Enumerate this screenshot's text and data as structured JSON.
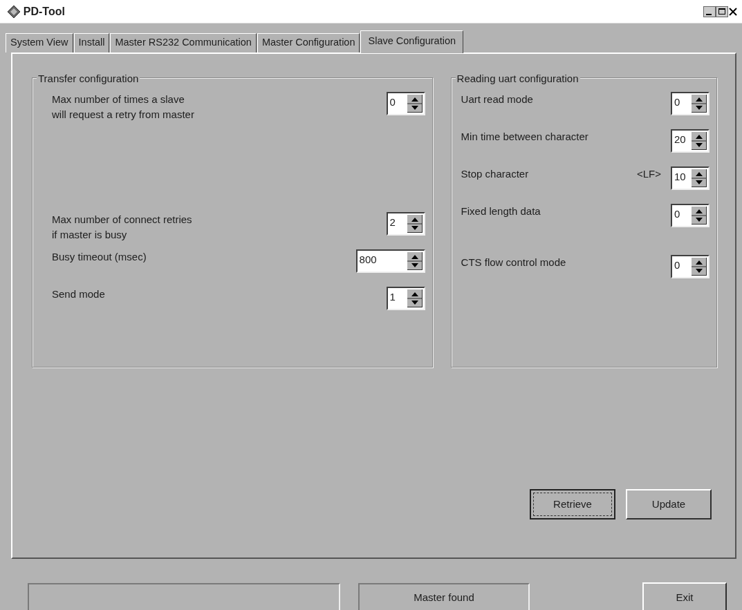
{
  "window": {
    "title": "PD-Tool"
  },
  "tabs": [
    {
      "label": "System View",
      "selected": false
    },
    {
      "label": "Install",
      "selected": false
    },
    {
      "label": "Master RS232 Communication",
      "selected": false
    },
    {
      "label": "Master Configuration",
      "selected": false
    },
    {
      "label": "Slave Configuration",
      "selected": true
    }
  ],
  "groups": [
    {
      "title": "Transfer configuration",
      "sections": [
        [
          {
            "label": "Max number of times a slave\nwill request a retry from master",
            "value": "0",
            "kind": "narrow"
          }
        ],
        [
          {
            "label": "Max number of connect retries\nif master is busy",
            "value": "2",
            "kind": "narrow"
          },
          {
            "label": "Busy timeout (msec)",
            "value": "800",
            "kind": "wide"
          },
          {
            "label": "Send mode",
            "value": "1",
            "kind": "narrow"
          }
        ]
      ]
    },
    {
      "title": "Reading uart configuration",
      "sections": [
        [
          {
            "label": "Uart read mode",
            "value": "0",
            "kind": "narrow"
          },
          {
            "label": "Min time between character",
            "value": "20",
            "kind": "narrow"
          },
          {
            "label": "Stop character",
            "note": "<LF>",
            "value": "10",
            "kind": "narrow"
          },
          {
            "label": "Fixed length data",
            "value": "0",
            "kind": "narrow"
          }
        ],
        [
          {
            "label": "CTS flow control mode",
            "value": "0",
            "kind": "narrow"
          }
        ]
      ]
    }
  ],
  "buttons": [
    {
      "label": "Retrieve",
      "focused": true
    },
    {
      "label": "Update",
      "focused": false
    }
  ],
  "status_fields": [
    {
      "kind": "empty"
    },
    {
      "kind": "text",
      "text": "Master found"
    }
  ],
  "exit_button": {
    "label": "Exit"
  }
}
